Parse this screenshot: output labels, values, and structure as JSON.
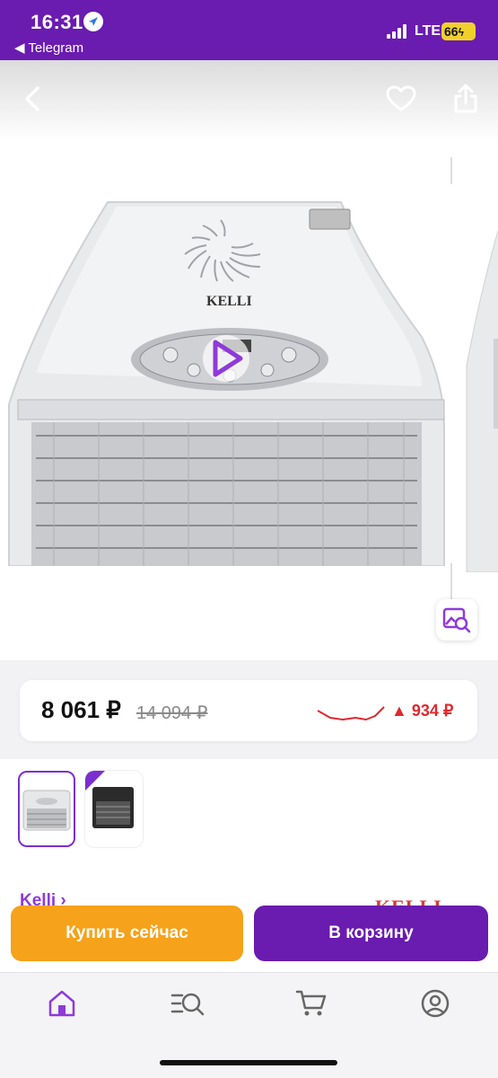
{
  "status_bar": {
    "time": "16:31",
    "back_app": "◀ Telegram",
    "network": "LTE",
    "battery": "66"
  },
  "product": {
    "price_current": "8 061 ₽",
    "price_old": "14 094 ₽",
    "price_change": "▲ 934 ₽",
    "image_brand_text": "KELLI",
    "brand_link": "Kelli ›",
    "brand_logo": "KELLI",
    "buy_now_label": "Купить сейчас",
    "add_to_cart_label": "В корзину"
  },
  "colors": {
    "brand_purple": "#6a1bb0",
    "buy_orange": "#f6a21a",
    "price_up_red": "#e0282e"
  },
  "icons": {
    "header": [
      "back-arrow-icon",
      "heart-icon",
      "share-icon"
    ],
    "tabbar": [
      "home-icon",
      "catalog-search-icon",
      "cart-icon",
      "profile-icon"
    ]
  }
}
